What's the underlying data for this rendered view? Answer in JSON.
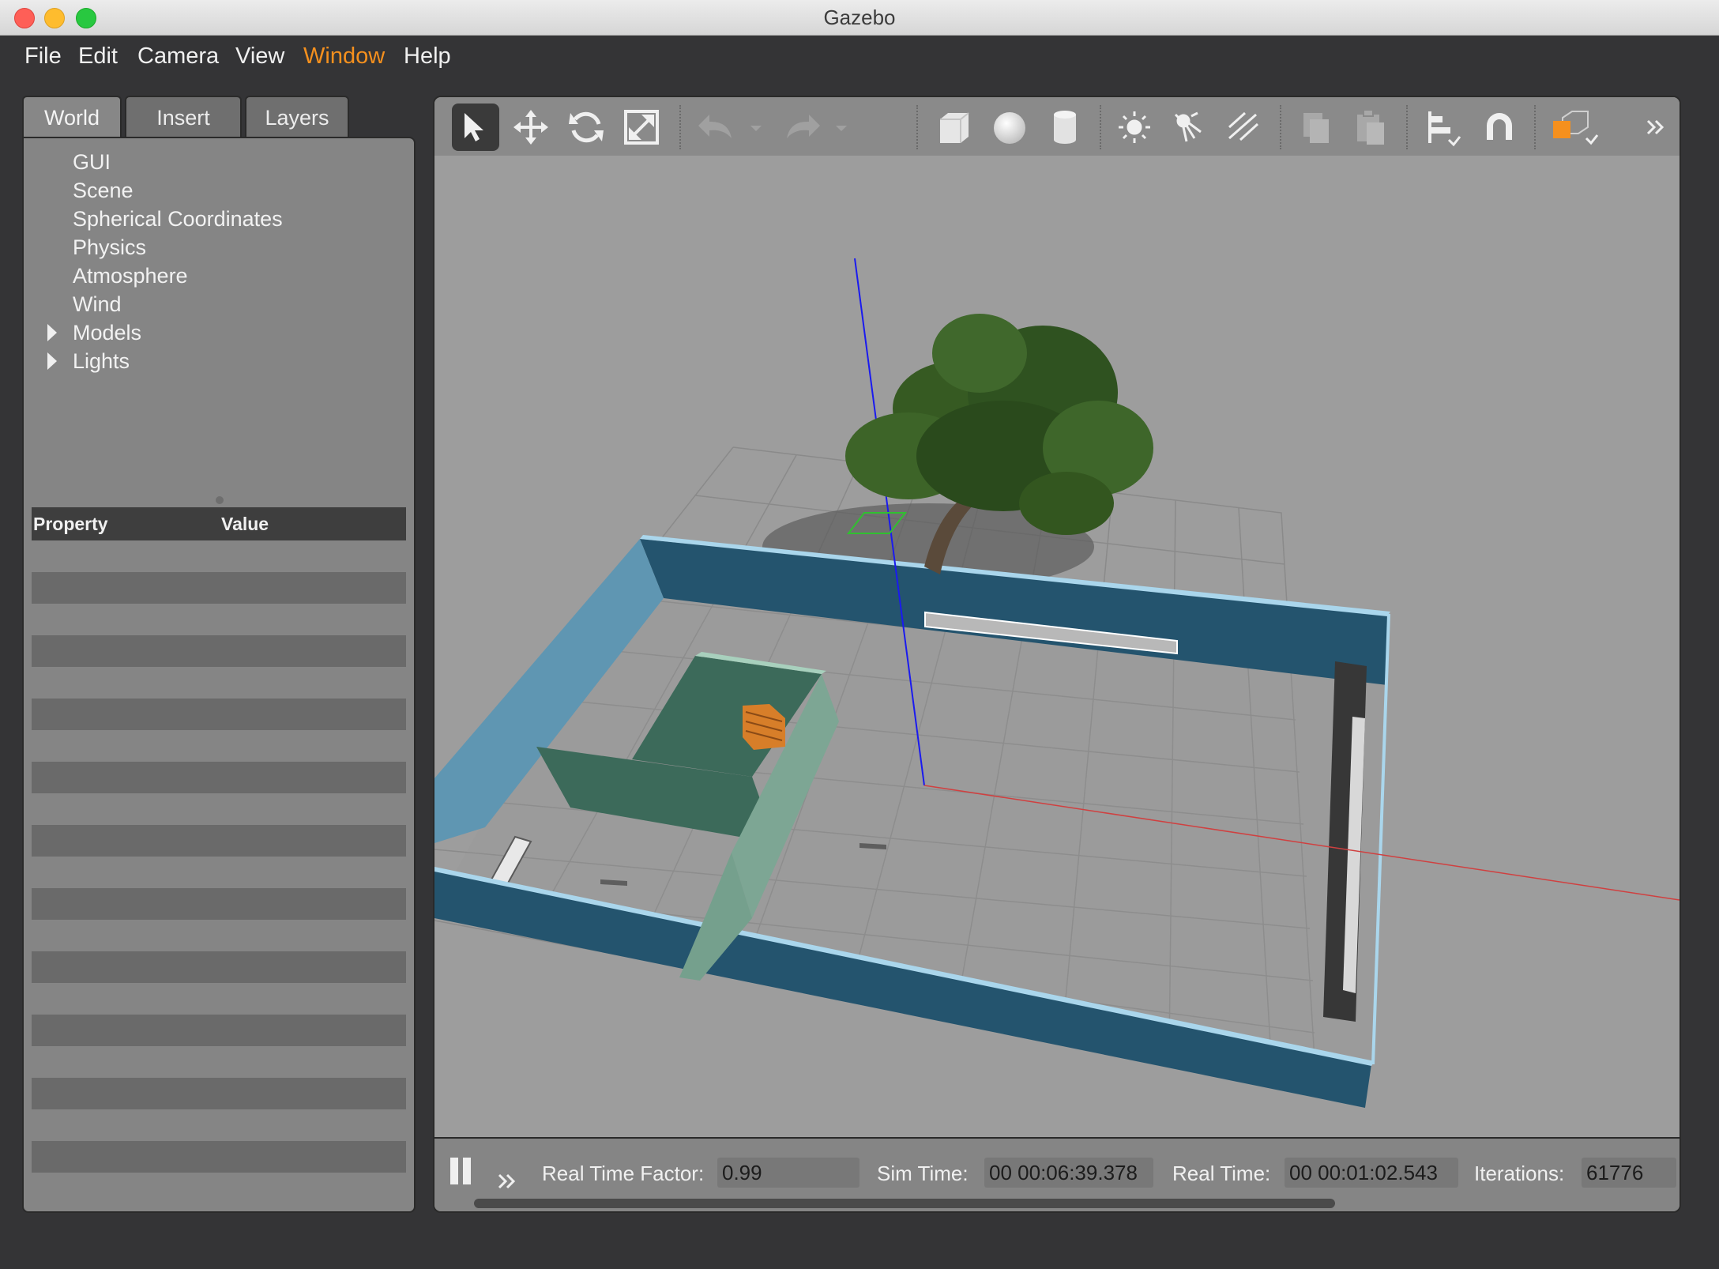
{
  "window": {
    "title": "Gazebo"
  },
  "menu": [
    "File",
    "Edit",
    "Camera",
    "View",
    "Window",
    "Help"
  ],
  "menu_active": "Window",
  "tabs": [
    "World",
    "Insert",
    "Layers"
  ],
  "tree": [
    {
      "label": "GUI"
    },
    {
      "label": "Scene"
    },
    {
      "label": "Spherical Coordinates"
    },
    {
      "label": "Physics"
    },
    {
      "label": "Atmosphere"
    },
    {
      "label": "Wind"
    },
    {
      "label": "Models"
    },
    {
      "label": "Lights"
    }
  ],
  "properties": {
    "col_property": "Property",
    "col_value": "Value"
  },
  "toolbar_icons": [
    "select-arrow-icon",
    "translate-icon",
    "rotate-icon",
    "scale-icon",
    "undo-icon",
    "redo-icon",
    "box-icon",
    "sphere-icon",
    "cylinder-icon",
    "point-light-icon",
    "spot-light-icon",
    "directional-light-icon",
    "copy-icon",
    "paste-icon",
    "align-icon",
    "magnet-snap-icon",
    "view-angle-icon",
    "more-icon"
  ],
  "status": {
    "rtf_label": "Real Time Factor:",
    "rtf_value": "0.99",
    "sim_label": "Sim Time:",
    "sim_value": "00 00:06:39.378",
    "real_label": "Real Time:",
    "real_value": "00 00:01:02.543",
    "iter_label": "Iterations:",
    "iter_value": "61776"
  },
  "colors": {
    "accent": "#f5901e",
    "wall": "#2a5f7b",
    "inner_wall": "#3d6a5a",
    "ground": "#9d9d9d"
  }
}
